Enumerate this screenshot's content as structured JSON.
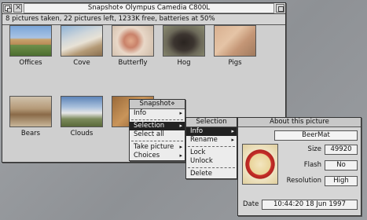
{
  "snapshot_window": {
    "title": "Snapshot⋄ Olympus Camedia C800L",
    "status": "8 pictures taken, 22 pictures left, 1233K free, batteries at 50%",
    "pictures": [
      {
        "label": "Offices"
      },
      {
        "label": "Cove"
      },
      {
        "label": "Butterfly"
      },
      {
        "label": "Hog"
      },
      {
        "label": "Pigs"
      },
      {
        "label": "Bears"
      },
      {
        "label": "Clouds"
      },
      {
        "label": ""
      }
    ]
  },
  "snapshot_menu": {
    "title": "Snapshot⋄",
    "items": [
      {
        "label": "Info"
      },
      {
        "label": "Selection"
      },
      {
        "label": "Select all"
      },
      {
        "label": "Take picture"
      },
      {
        "label": "Choices"
      }
    ]
  },
  "selection_menu": {
    "title": "Selection",
    "items": [
      {
        "label": "Info"
      },
      {
        "label": "Rename"
      },
      {
        "label": "Lock"
      },
      {
        "label": "Unlock"
      },
      {
        "label": "Delete"
      }
    ]
  },
  "about_window": {
    "title": "About this picture",
    "name": "BeerMat",
    "size_label": "Size",
    "size_value": "49920",
    "flash_label": "Flash",
    "flash_value": "No",
    "resolution_label": "Resolution",
    "resolution_value": "High",
    "date_label": "Date",
    "date_value": "10:44:20 18 Jun 1997"
  }
}
